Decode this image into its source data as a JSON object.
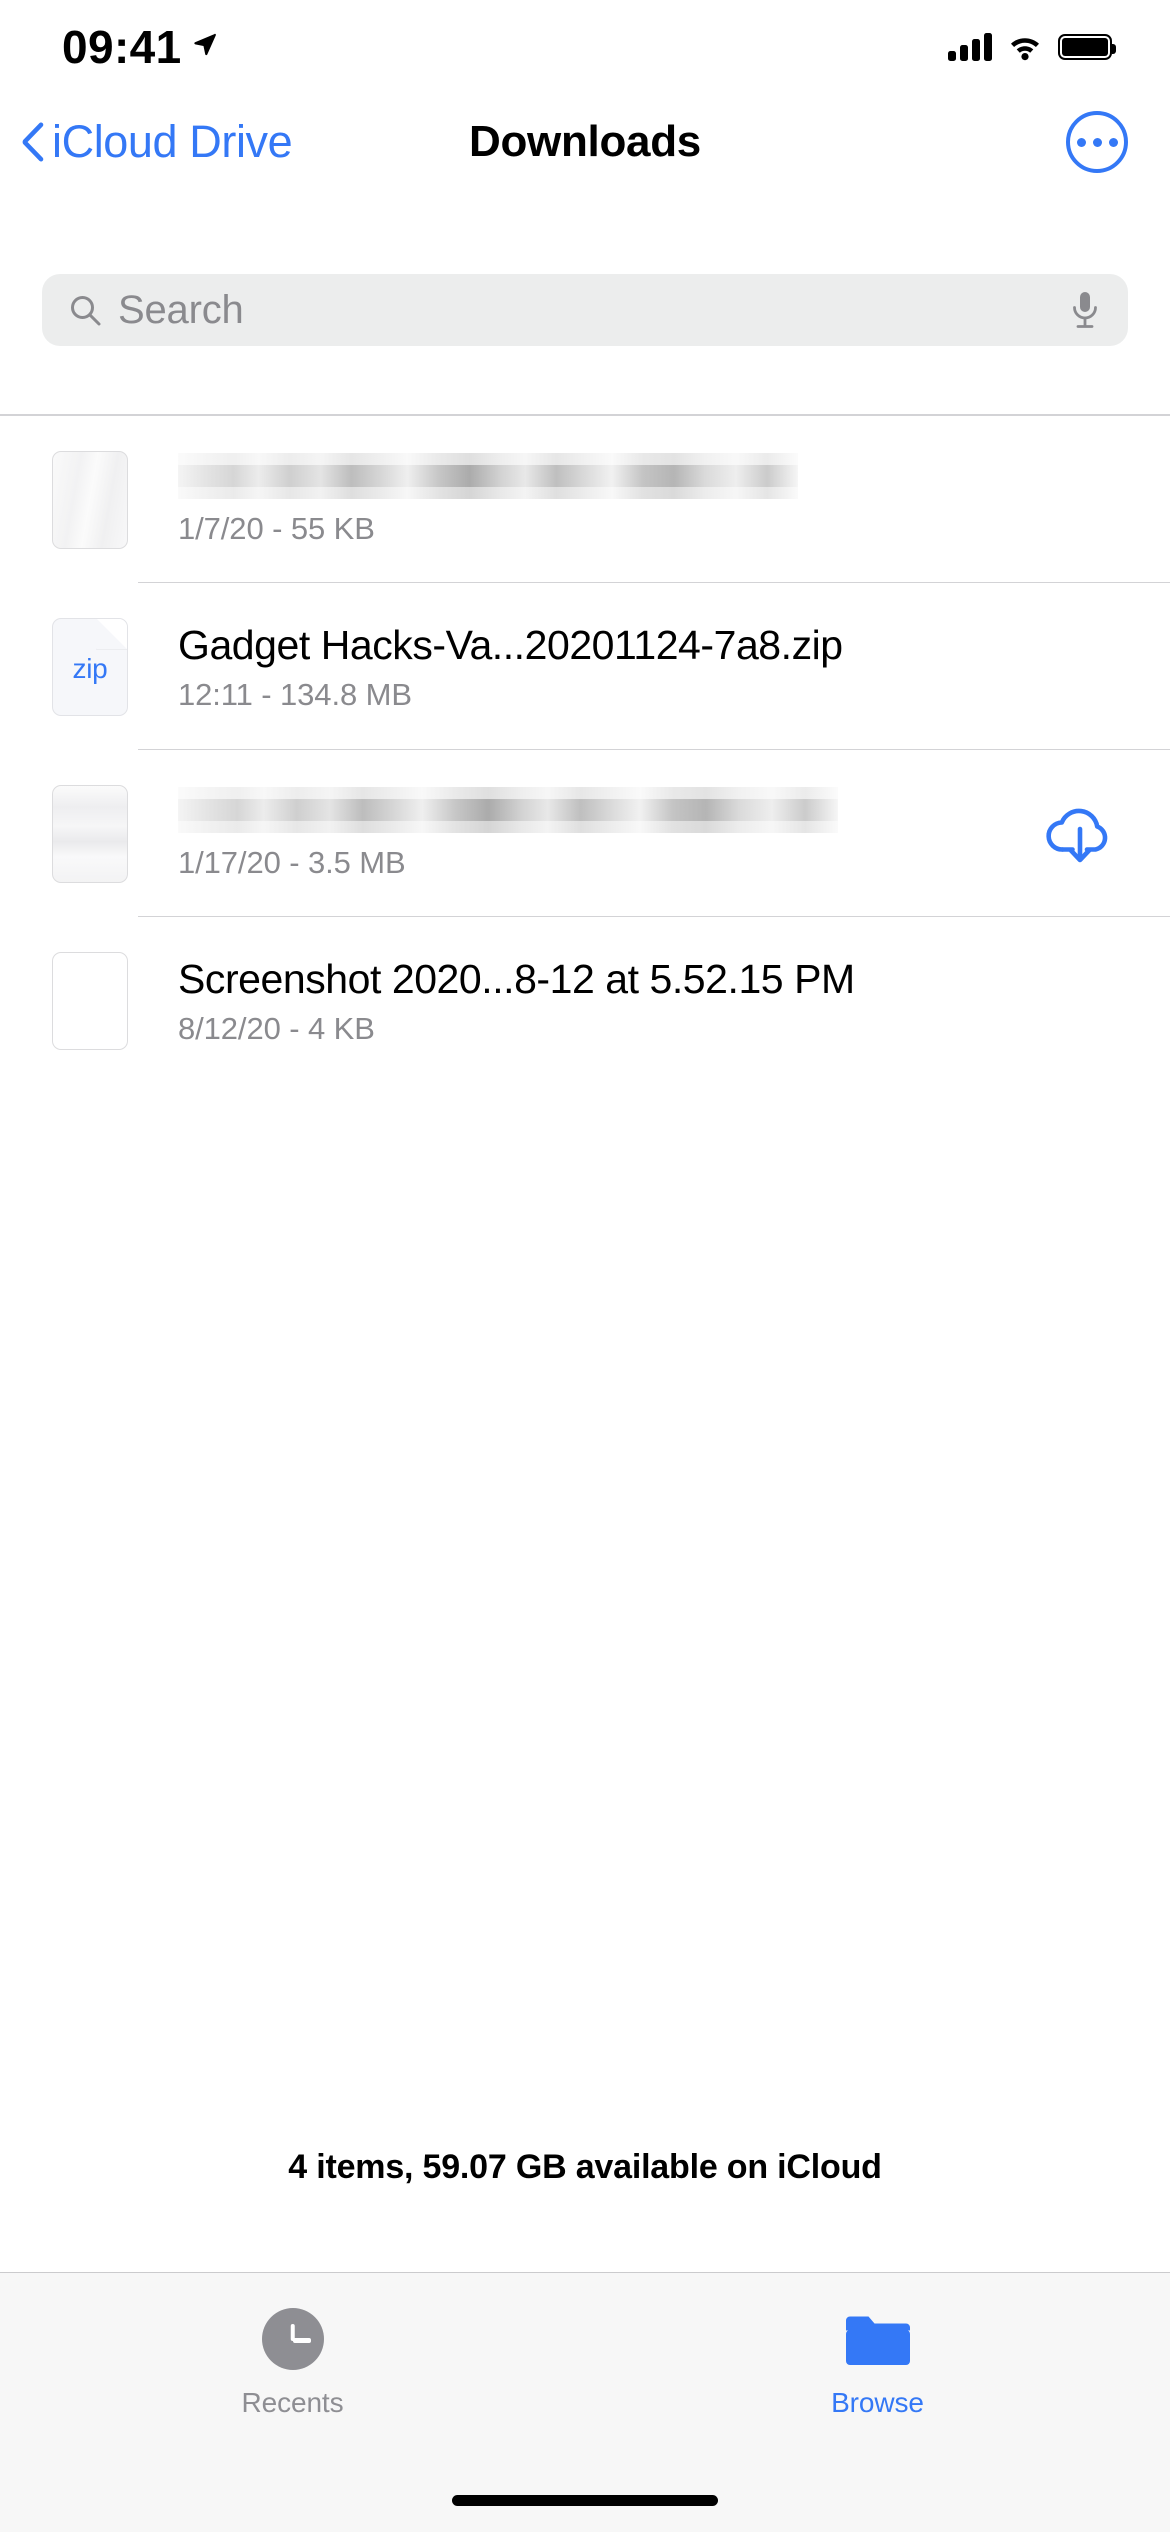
{
  "status_bar": {
    "time": "09:41",
    "location_icon": "location-arrow-icon",
    "cellular_icon": "cellular-signal-icon",
    "wifi_icon": "wifi-icon",
    "battery_icon": "battery-full-icon"
  },
  "nav": {
    "back_label": "iCloud Drive",
    "back_icon": "chevron-left-icon",
    "title": "Downloads",
    "more_icon": "more-options-icon"
  },
  "search": {
    "placeholder": "Search",
    "value": "",
    "search_icon": "search-icon",
    "mic_icon": "microphone-icon"
  },
  "files": [
    {
      "name": "",
      "name_redacted": true,
      "subtitle": "1/7/20 - 55 KB",
      "icon": "document-thumbnail",
      "accessory": ""
    },
    {
      "name": "Gadget Hacks-Va...20201124-7a8.zip",
      "name_redacted": false,
      "subtitle": "12:11 - 134.8 MB",
      "icon": "zip-file-icon",
      "icon_label": "zip",
      "accessory": ""
    },
    {
      "name": "",
      "name_redacted": true,
      "subtitle": "1/17/20 - 3.5 MB",
      "icon": "document-thumbnail",
      "accessory": "cloud-download-icon"
    },
    {
      "name": "Screenshot 2020...8-12 at 5.52.15 PM",
      "name_redacted": false,
      "subtitle": "8/12/20 - 4 KB",
      "icon": "document-thumbnail",
      "accessory": ""
    }
  ],
  "footer": {
    "status": "4 items, 59.07 GB available on iCloud"
  },
  "tab_bar": {
    "items": [
      {
        "label": "Recents",
        "icon": "clock-icon",
        "active": false
      },
      {
        "label": "Browse",
        "icon": "folder-icon",
        "active": true
      }
    ]
  },
  "colors": {
    "accent_blue": "#3478f6",
    "secondary_text": "#8a8a8e",
    "separator": "#d3d3d6",
    "search_field": "#eceded",
    "tab_bar_bg": "#f7f7f7"
  }
}
